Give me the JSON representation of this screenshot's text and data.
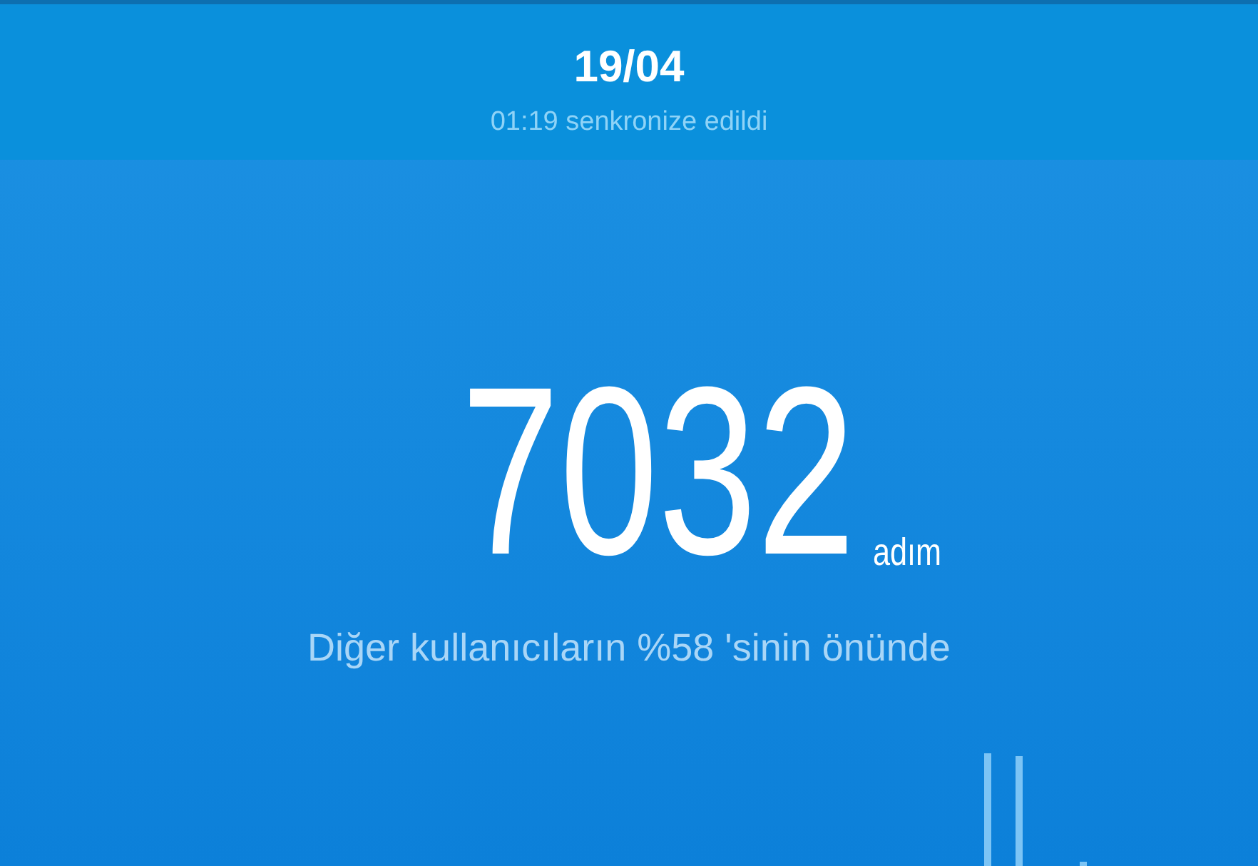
{
  "header": {
    "date": "19/04",
    "sync_status": "01:19 senkronize edildi"
  },
  "steps": {
    "count": "7032",
    "unit": "adım",
    "comparison": "Diğer kullanıcıların %58 'sinin önünde"
  }
}
